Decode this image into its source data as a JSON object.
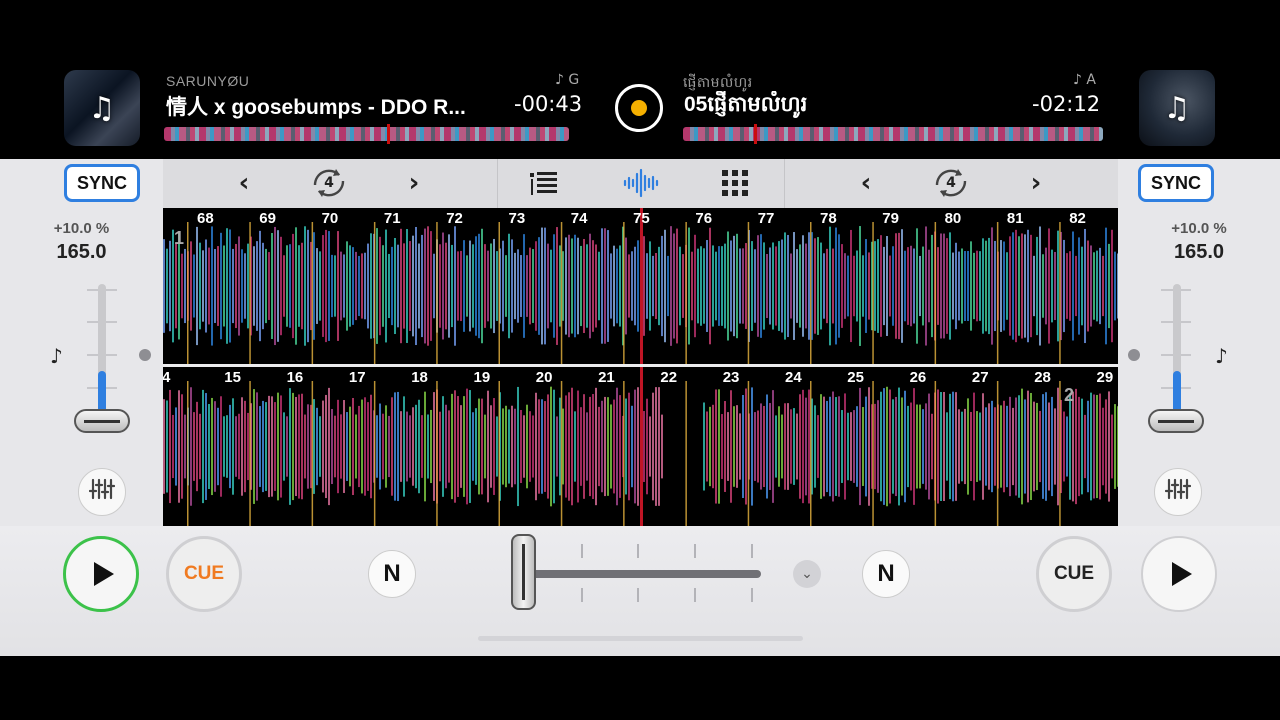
{
  "deck_a": {
    "artist": "SARUNYØU",
    "title": "情人 x goosebumps - DDO R...",
    "time": "-00:43",
    "key": "♪ G",
    "playhead_fraction": 0.55
  },
  "deck_b": {
    "artist": "ផ្ញើតាមលំហូរ",
    "title": "05ផ្ញើតាមលំហូរ",
    "time": "-02:12",
    "key": "♪ A",
    "playhead_fraction": 0.17
  },
  "left_side": {
    "sync_label": "SYNC",
    "pitch_range": "+10.0 %",
    "bpm": "165.0",
    "pitch_level": 0.37
  },
  "right_side": {
    "sync_label": "SYNC",
    "pitch_range": "+10.0 %",
    "bpm": "165.0",
    "pitch_level": 0.37
  },
  "toolbar": {
    "left_loop": "4",
    "right_loop": "4",
    "prev_glyph": "‹",
    "next_glyph": "›"
  },
  "wave_top": {
    "deck_number": "1",
    "beat_labels": [
      "68",
      "69",
      "70",
      "71",
      "72",
      "73",
      "74",
      "75",
      "76",
      "77",
      "78",
      "79",
      "80",
      "81",
      "82"
    ]
  },
  "wave_bottom": {
    "deck_number": "2",
    "beat_labels": [
      "4",
      "15",
      "16",
      "17",
      "18",
      "19",
      "20",
      "21",
      "22",
      "23",
      "24",
      "25",
      "26",
      "27",
      "28",
      "29"
    ]
  },
  "controls": {
    "cue_left": "CUE",
    "cue_right": "CUE",
    "n_left": "N",
    "n_right": "N",
    "crossfader_level": 0.0
  },
  "colors": {
    "accent": "#2f7fe0",
    "play_active": "#3cc24a",
    "cue_active": "#f07a20",
    "record": "#f5b000"
  },
  "icons": {
    "cover_a": "music-note-icon",
    "cover_b": "music-note-icon",
    "record": "record-icon",
    "mixer": "mixer-list-icon",
    "waveform": "waveform-icon",
    "pads": "grid-pads-icon",
    "eq": "eq-sliders-icon",
    "more": "chevron-down-icon"
  }
}
